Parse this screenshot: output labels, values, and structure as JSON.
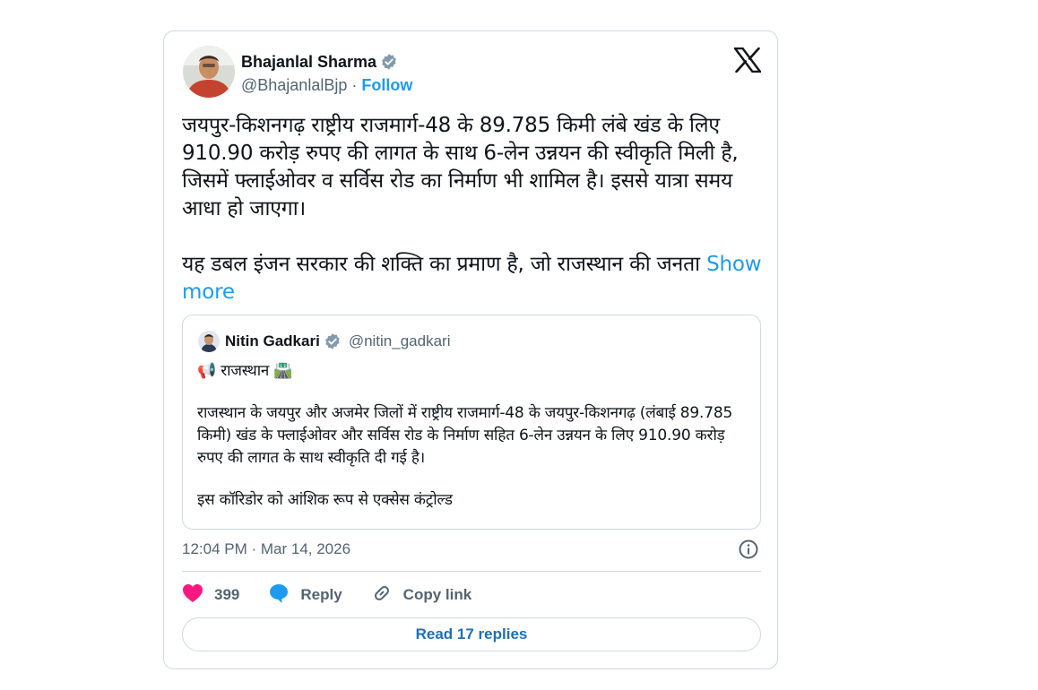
{
  "author": {
    "name": "Bhajanlal Sharma",
    "handle": "@BhajanlalBjp",
    "separator": "·",
    "follow_label": "Follow"
  },
  "tweet": {
    "paragraph1": "जयपुर-किशनगढ़ राष्ट्रीय राजमार्ग-48 के 89.785 किमी लंबे खंड के लिए 910.90 करोड़ रुपए की लागत के साथ 6-लेन उन्नयन की स्वीकृति मिली है, जिसमें फ्लाईओवर व सर्विस रोड का निर्माण भी शामिल है। इससे यात्रा समय आधा हो जाएगा।",
    "paragraph2": "यह डबल इंजन सरकार की शक्ति का प्रमाण है, जो राजस्थान की जनता",
    "show_more": "Show more"
  },
  "quoted": {
    "name": "Nitin Gadkari",
    "handle": "@nitin_gadkari",
    "heading_prefix": "📢",
    "heading": "राजस्थान",
    "heading_suffix": "🛣️",
    "paragraph1": "राजस्थान के जयपुर और अजमेर जिलों में राष्ट्रीय राजमार्ग-48 के जयपुर-किशनगढ़ (लंबाई 89.785 किमी) खंड के फ्लाईओवर और सर्विस रोड के निर्माण सहित 6-लेन उन्नयन के लिए 910.90 करोड़ रुपए की लागत के साथ स्वीकृति दी गई है।",
    "paragraph2": "इस कॉरिडोर को आंशिक रूप से एक्सेस कंट्रोल्ड"
  },
  "meta": {
    "timestamp": "12:04 PM · Mar 14, 2026"
  },
  "actions": {
    "likes": "399",
    "reply": "Reply",
    "copy_link": "Copy link"
  },
  "read_replies": "Read 17 replies",
  "colors": {
    "accent": "#1d9bf0",
    "like": "#f91880",
    "border": "#cfd9de",
    "muted": "#536471"
  }
}
